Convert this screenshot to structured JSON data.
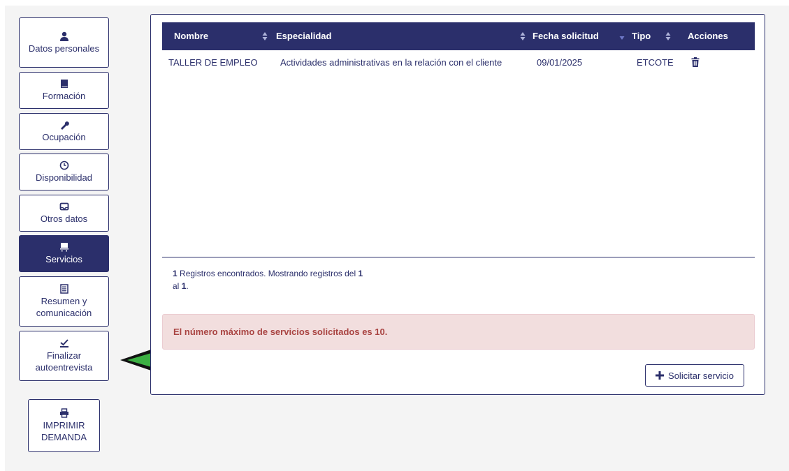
{
  "sidebar": {
    "items": [
      {
        "label": "Datos personales",
        "icon": "user-icon",
        "active": false
      },
      {
        "label": "Formación",
        "icon": "book-icon",
        "active": false
      },
      {
        "label": "Ocupación",
        "icon": "wrench-icon",
        "active": false
      },
      {
        "label": "Disponibilidad",
        "icon": "clock-icon",
        "active": false
      },
      {
        "label": "Otros datos",
        "icon": "inbox-icon",
        "active": false
      },
      {
        "label": "Servicios",
        "icon": "services-icon",
        "active": true
      },
      {
        "label": "Resumen y comunicación",
        "icon": "list-alt-icon",
        "active": false
      },
      {
        "label": "Finalizar autoentrevista",
        "icon": "check-icon",
        "active": false
      }
    ],
    "print_label_1": "IMPRIMIR",
    "print_label_2": "DEMANDA"
  },
  "table": {
    "columns": [
      "Nombre",
      "Especialidad",
      "Fecha solicitud",
      "Tipo",
      "Acciones"
    ],
    "rows": [
      {
        "nombre": "TALLER DE EMPLEO",
        "especialidad": "Actividades administrativas en la relación con el cliente",
        "fecha": "09/01/2025",
        "tipo": "ETCOTE",
        "accion_icon": "trash-icon"
      }
    ]
  },
  "records": {
    "count": "1",
    "text_1": " Registros encontrados. Mostrando registros del ",
    "from": "1",
    "text_2": "al ",
    "to": "1",
    "text_3": "."
  },
  "alert": {
    "text": "El número máximo de servicios solicitados es 10."
  },
  "solicitar_label": "Solicitar servicio",
  "colors": {
    "primary": "#2b2f6b",
    "alert_bg": "#f2dede",
    "alert_text": "#a94442",
    "annotation_arrow": "#3cb043"
  }
}
